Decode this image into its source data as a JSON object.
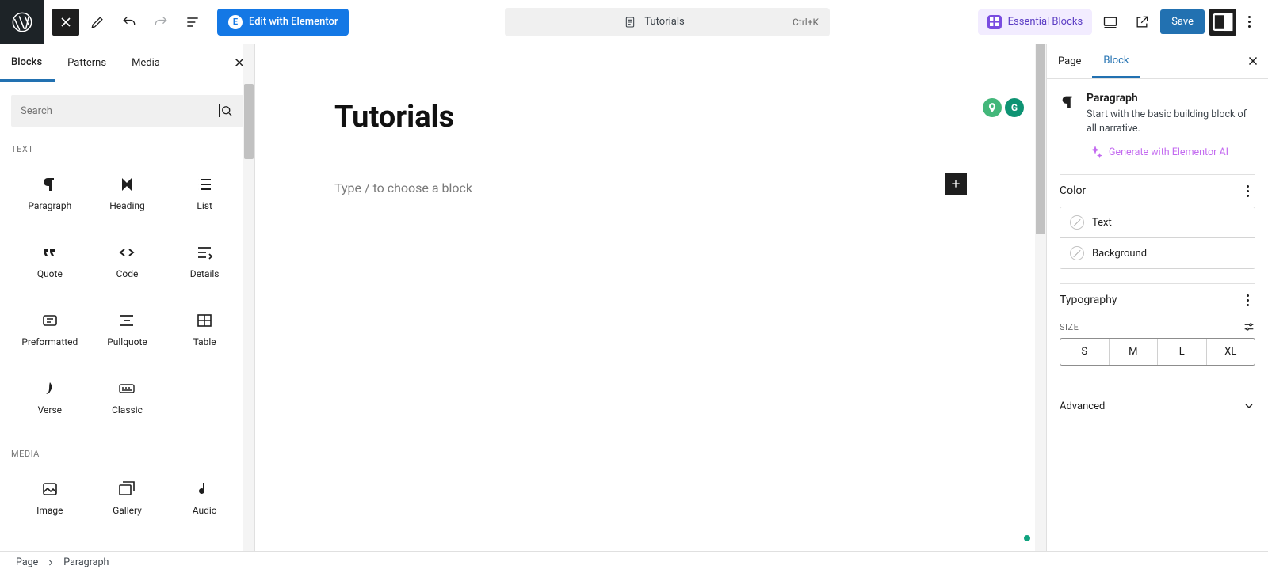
{
  "topbar": {
    "elementor_label": "Edit with Elementor",
    "doc_title": "Tutorials",
    "shortcut": "Ctrl+K",
    "essential_blocks": "Essential Blocks",
    "save_label": "Save"
  },
  "inserter": {
    "tabs": [
      "Blocks",
      "Patterns",
      "Media"
    ],
    "active_tab": 0,
    "search_placeholder": "Search",
    "cat_text": "TEXT",
    "cat_media": "MEDIA",
    "blocks_text": [
      {
        "name": "paragraph",
        "label": "Paragraph"
      },
      {
        "name": "heading",
        "label": "Heading"
      },
      {
        "name": "list",
        "label": "List"
      },
      {
        "name": "quote",
        "label": "Quote"
      },
      {
        "name": "code",
        "label": "Code"
      },
      {
        "name": "details",
        "label": "Details"
      },
      {
        "name": "preformatted",
        "label": "Preformatted"
      },
      {
        "name": "pullquote",
        "label": "Pullquote"
      },
      {
        "name": "table",
        "label": "Table"
      },
      {
        "name": "verse",
        "label": "Verse"
      },
      {
        "name": "classic",
        "label": "Classic"
      }
    ],
    "blocks_media": [
      {
        "name": "image",
        "label": "Image"
      },
      {
        "name": "gallery",
        "label": "Gallery"
      },
      {
        "name": "audio",
        "label": "Audio"
      }
    ]
  },
  "canvas": {
    "title": "Tutorials",
    "placeholder": "Type / to choose a block"
  },
  "settings": {
    "tabs": [
      "Page",
      "Block"
    ],
    "active_tab": 1,
    "block_name": "Paragraph",
    "block_desc": "Start with the basic building block of all narrative.",
    "ai_link": "Generate with Elementor AI",
    "section_color": "Color",
    "color_text_label": "Text",
    "color_bg_label": "Background",
    "section_typo": "Typography",
    "size_label": "SIZE",
    "sizes": [
      "S",
      "M",
      "L",
      "XL"
    ],
    "section_adv": "Advanced"
  },
  "footer": {
    "crumb_root": "Page",
    "crumb_current": "Paragraph"
  }
}
